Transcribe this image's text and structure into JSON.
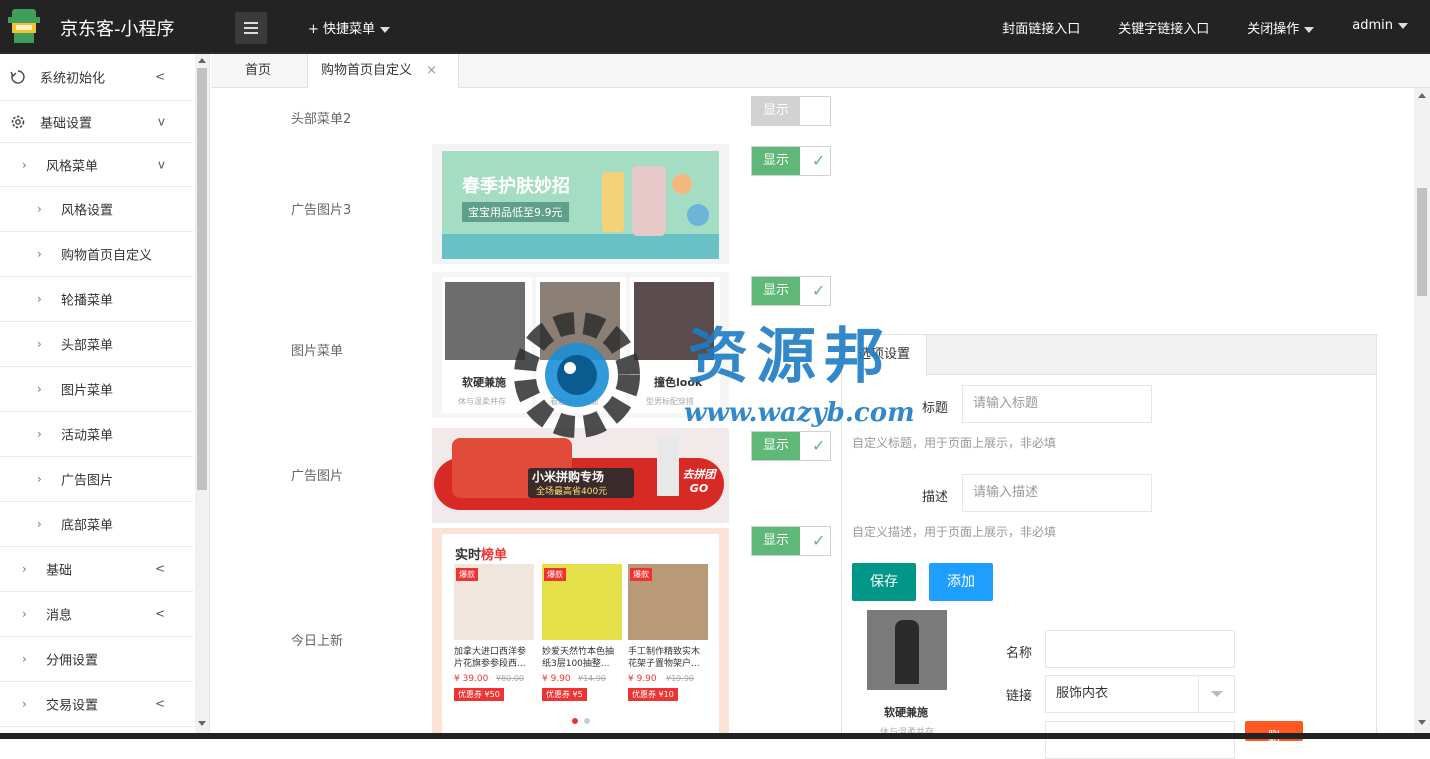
{
  "header": {
    "app_title": "京东客-小程序",
    "quick_menu": "+ 快捷菜单",
    "links": [
      "封面链接入口",
      "关键字链接入口",
      "关闭操作",
      "admin"
    ]
  },
  "sidebar": {
    "items": [
      {
        "label": "系统初始化",
        "icon": "refresh-icon",
        "chevron": "<"
      },
      {
        "label": "基础设置",
        "icon": "gear-icon",
        "chevron": "v"
      },
      {
        "label": "风格菜单",
        "chevron": "v"
      },
      {
        "label": "风格设置"
      },
      {
        "label": "购物首页自定义"
      },
      {
        "label": "轮播菜单"
      },
      {
        "label": "头部菜单"
      },
      {
        "label": "图片菜单"
      },
      {
        "label": "活动菜单"
      },
      {
        "label": "广告图片"
      },
      {
        "label": "底部菜单"
      },
      {
        "label": "基础",
        "chevron": "<"
      },
      {
        "label": "消息",
        "chevron": "<"
      },
      {
        "label": "分佣设置"
      },
      {
        "label": "交易设置",
        "chevron": "<"
      }
    ]
  },
  "tabs": {
    "home": "首页",
    "active": "购物首页自定义",
    "close": "×"
  },
  "rows": [
    {
      "label": "头部菜单2",
      "toggle": "显示",
      "on": false
    },
    {
      "label": "广告图片3",
      "toggle": "显示",
      "on": true
    },
    {
      "label": "图片菜单",
      "toggle": "显示",
      "on": true
    },
    {
      "label": "广告图片",
      "toggle": "显示",
      "on": true
    },
    {
      "label": "今日上新",
      "toggle": "显示",
      "on": true
    }
  ],
  "banner3": {
    "title": "春季护肤妙招",
    "subtitle": "宝宝用品低至9.9元"
  },
  "image_menu": {
    "captions": [
      "软硬兼施",
      "撞色look"
    ],
    "subs": [
      "休与温柔并存",
      "看起来很风潮",
      "型男标配穿搭"
    ]
  },
  "ad_banner": {
    "title": "小米拼购专场",
    "subtitle": "全场最高省400元",
    "cta": "去拼团GO"
  },
  "today_new": {
    "title_a": "实时",
    "title_b": "榜单",
    "badge": "爆款",
    "items": [
      {
        "name": "加拿大进口西洋参片花旗参参段西...",
        "price": "¥ 39.00",
        "old": "¥80.00",
        "coupon": "优惠券 ¥50"
      },
      {
        "name": "妙爱天然竹本色抽纸3层100抽整...",
        "price": "¥ 9.90",
        "old": "¥14.90",
        "coupon": "优惠券 ¥5"
      },
      {
        "name": "手工制作精致实木花架子置物架户...",
        "price": "¥ 9.90",
        "old": "¥19.90",
        "coupon": "优惠券 ¥10"
      }
    ]
  },
  "panel": {
    "tab": "选项设置",
    "title_label": "标题",
    "title_placeholder": "请输入标题",
    "title_hint": "自定义标题，用于页面上展示，非必填",
    "desc_label": "描述",
    "desc_placeholder": "请输入描述",
    "desc_hint": "自定义描述，用于页面上展示，非必填",
    "save": "保存",
    "add": "添加",
    "item_caption": "软硬兼施",
    "item_sub": "休与温柔并存",
    "name_label": "名称",
    "link_label": "链接",
    "link_value": "服饰内衣",
    "del": "删"
  },
  "watermark": {
    "text": "资源邦",
    "url": "www.wazyb.com"
  },
  "colors": {
    "toggle_on": "#5fb878",
    "save": "#009688",
    "add": "#1e9fff",
    "delete": "#ff5722"
  }
}
